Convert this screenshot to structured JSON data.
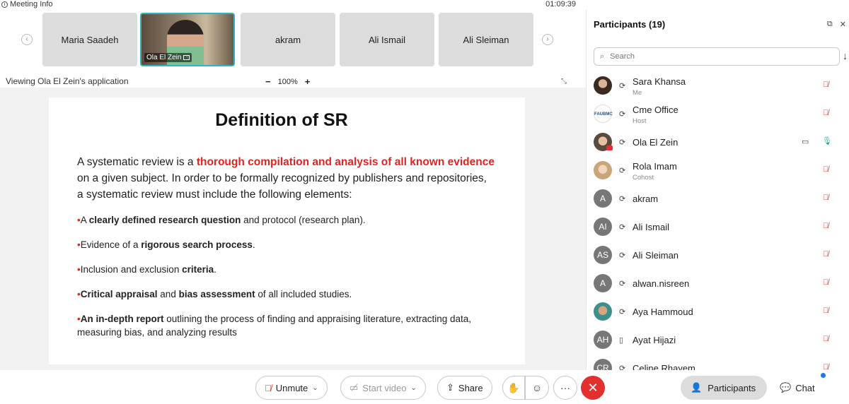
{
  "topbar": {
    "meeting_info": "Meeting Info",
    "timer": "01:09:39"
  },
  "strip": {
    "thumbnails": [
      {
        "name": "Maria Saadeh"
      },
      {
        "name": "Ola El Zein",
        "video": true
      },
      {
        "name": "akram"
      },
      {
        "name": "Ali Ismail"
      },
      {
        "name": "Ali Sleiman"
      }
    ]
  },
  "viewing": {
    "text": "Viewing Ola El Zein's application",
    "zoom_minus": "−",
    "zoom_level": "100%",
    "zoom_plus": "+"
  },
  "slide": {
    "title": "Definition of SR",
    "intro_prefix": "A systematic review is a ",
    "intro_highlight": "thorough compilation and analysis of all known evidence",
    "intro_suffix": " on a given subject. In order to be formally recognized by publishers and repositories, a systematic review must include the following elements:",
    "bullets": [
      {
        "pre": "A ",
        "bold": "clearly defined research question",
        "post": " and protocol (research plan)."
      },
      {
        "pre": "Evidence of a ",
        "bold": "rigorous search process",
        "post": "."
      },
      {
        "pre": "Inclusion and exclusion ",
        "bold": "criteria",
        "post": "."
      },
      {
        "pre": "",
        "bold": "Critical appraisal",
        "mid": " and ",
        "bold2": "bias assessment",
        "post": " of all included studies."
      },
      {
        "pre": "",
        "bold": "An in-depth report",
        "post": " outlining the process of finding and appraising literature, extracting data, measuring bias, and analyzing results"
      }
    ]
  },
  "controls": {
    "unmute": "Unmute",
    "start_video": "Start video",
    "share": "Share",
    "more": "···",
    "participants": "Participants",
    "chat": "Chat"
  },
  "panel": {
    "title": "Participants (19)",
    "search_placeholder": "Search",
    "participants": [
      {
        "name": "Sara Khansa",
        "role": "Me",
        "avatar": "photo1"
      },
      {
        "name": "Cme Office",
        "role": "Host",
        "avatar": "photo2",
        "avatar_text": "FAUBMC"
      },
      {
        "name": "Ola El Zein",
        "role": "",
        "avatar": "photo3",
        "video": true
      },
      {
        "name": "Rola Imam",
        "role": "Cohost",
        "avatar": "photo4"
      },
      {
        "name": "akram",
        "role": "",
        "initials": "A"
      },
      {
        "name": "Ali Ismail",
        "role": "",
        "initials": "AI"
      },
      {
        "name": "Ali Sleiman",
        "role": "",
        "initials": "AS"
      },
      {
        "name": "alwan.nisreen",
        "role": "",
        "initials": "A"
      },
      {
        "name": "Aya Hammoud",
        "role": "",
        "avatar": "photo5"
      },
      {
        "name": "Ayat Hijazi",
        "role": "",
        "initials": "AH",
        "device": "phone"
      },
      {
        "name": "Celine Rhayem",
        "role": "",
        "initials": "CR"
      }
    ]
  },
  "colors": {
    "accent_teal": "#2fb4c6",
    "end_call": "#e2302f",
    "highlight_red": "#e0241f",
    "mute_red": "#d9332b"
  }
}
